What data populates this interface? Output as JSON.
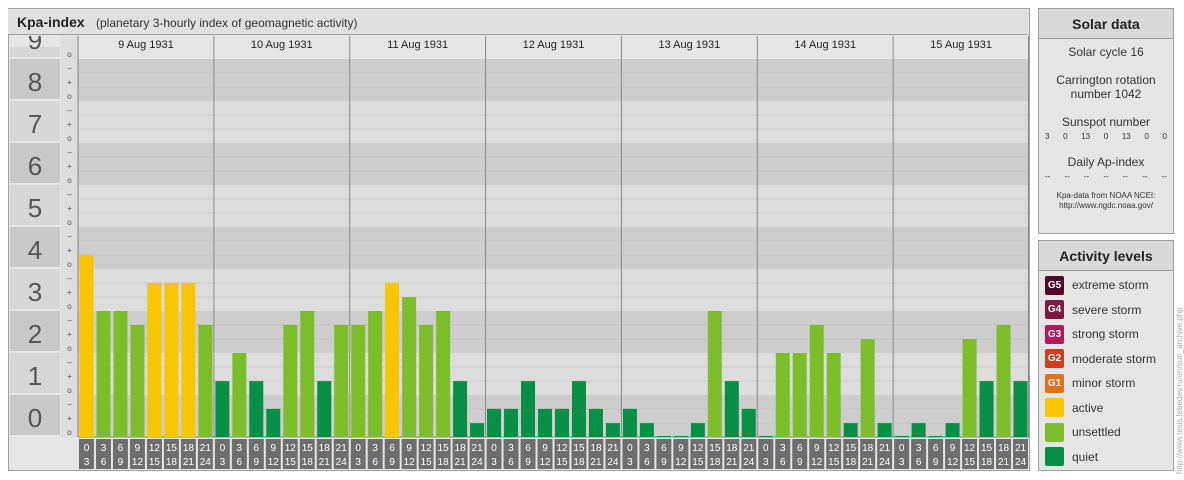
{
  "header": {
    "title": "Kpa-index",
    "subtitle": "(planetary 3-hourly index of geomagnetic activity)"
  },
  "solar": {
    "title": "Solar data",
    "cycle": "Solar cycle 16",
    "carrington_line1": "Carrington rotation",
    "carrington_line2": "number 1042",
    "sunspot_label": "Sunspot number",
    "sunspot_values": [
      "3",
      "0",
      "13",
      "0",
      "13",
      "0",
      "0"
    ],
    "ap_label": "Daily Ap-index",
    "ap_values": [
      "--",
      "--",
      "--",
      "--",
      "--",
      "--",
      "--"
    ],
    "credit_line1": "Kpa-data from NOAA NCEI:",
    "credit_line2": "http://www.ngdc.noaa.gov/"
  },
  "activity": {
    "title": "Activity levels",
    "levels": [
      {
        "badge": "G5",
        "label": "extreme storm",
        "color": "#4f0a28"
      },
      {
        "badge": "G4",
        "label": "severe storm",
        "color": "#7d1a44"
      },
      {
        "badge": "G3",
        "label": "strong storm",
        "color": "#b5185a"
      },
      {
        "badge": "G2",
        "label": "moderate storm",
        "color": "#d13b1e"
      },
      {
        "badge": "G1",
        "label": "minor storm",
        "color": "#e2721b"
      },
      {
        "badge": "",
        "label": "active",
        "color": "#f9c400"
      },
      {
        "badge": "",
        "label": "unsettled",
        "color": "#7cbe2a"
      },
      {
        "badge": "",
        "label": "quiet",
        "color": "#078f46"
      }
    ]
  },
  "watermark": "http://www.tesis.lebedev.ru/en/sun_archive.php",
  "chart_data": {
    "type": "bar",
    "ylim": [
      0,
      9
    ],
    "y_ticks": [
      "0",
      "1",
      "2",
      "3",
      "4",
      "5",
      "6",
      "7",
      "8",
      "9"
    ],
    "sub_tick_labels": [
      "+",
      "o",
      "–"
    ],
    "interval_labels": [
      [
        "0",
        "3"
      ],
      [
        "3",
        "6"
      ],
      [
        "6",
        "9"
      ],
      [
        "9",
        "12"
      ],
      [
        "12",
        "15"
      ],
      [
        "15",
        "18"
      ],
      [
        "18",
        "21"
      ],
      [
        "21",
        "24"
      ]
    ],
    "days": [
      {
        "date": "9 Aug 1931",
        "kp": [
          4.33,
          3.0,
          3.0,
          2.67,
          3.67,
          3.67,
          3.67,
          2.67
        ]
      },
      {
        "date": "10 Aug 1931",
        "kp": [
          1.33,
          2.0,
          1.33,
          0.67,
          2.67,
          3.0,
          1.33,
          2.67
        ]
      },
      {
        "date": "11 Aug 1931",
        "kp": [
          2.67,
          3.0,
          3.67,
          3.33,
          2.67,
          3.0,
          1.33,
          0.33
        ]
      },
      {
        "date": "12 Aug 1931",
        "kp": [
          0.67,
          0.67,
          1.33,
          0.67,
          0.67,
          1.33,
          0.67,
          0.33
        ]
      },
      {
        "date": "13 Aug 1931",
        "kp": [
          0.67,
          0.33,
          0.0,
          0.0,
          0.33,
          3.0,
          1.33,
          0.67
        ]
      },
      {
        "date": "14 Aug 1931",
        "kp": [
          0.0,
          2.0,
          2.0,
          2.67,
          2.0,
          0.33,
          2.33,
          0.33
        ]
      },
      {
        "date": "15 Aug 1931",
        "kp": [
          0.0,
          0.33,
          0.0,
          0.33,
          2.33,
          1.33,
          2.67,
          1.33
        ]
      }
    ],
    "colors": {
      "active": "#f9c400",
      "unsettled": "#7cbe2a",
      "quiet": "#078f46"
    }
  }
}
